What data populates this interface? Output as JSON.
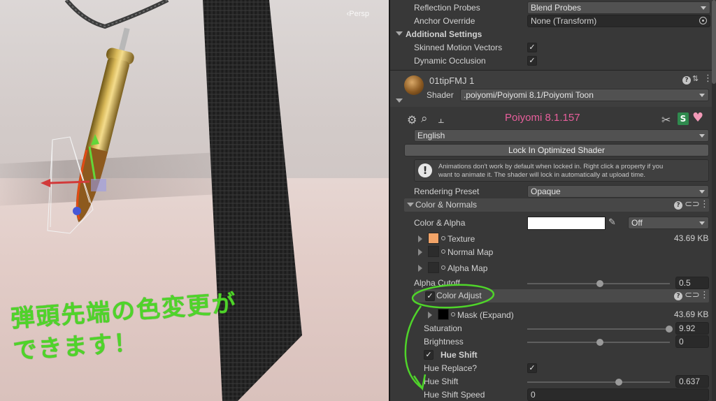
{
  "scene": {
    "persp_label": "‹Persp",
    "caption_line1": "弾頭先端の色変更が",
    "caption_line2": "できます！"
  },
  "top_rows": [
    {
      "label": "Reflection Probes",
      "value": "Blend Probes",
      "type": "dropdown"
    },
    {
      "label": "Anchor Override",
      "value": "None (Transform)",
      "type": "object"
    }
  ],
  "additional_settings": {
    "title": "Additional Settings",
    "rows": [
      {
        "label": "Skinned Motion Vectors",
        "checked": true
      },
      {
        "label": "Dynamic Occlusion",
        "checked": true
      }
    ]
  },
  "material": {
    "name": "01tipFMJ 1",
    "shader_label": "Shader",
    "shader_value": ".poiyomi/Poiyomi 8.1/Poiyomi Toon"
  },
  "poiyomi": {
    "title": "Poiyomi 8.1.157",
    "title_color": "#e85f9c",
    "language": "English",
    "lock_button": "Lock In Optimized Shader",
    "info_text_1": "Animations don't work by default when locked in. Right click a property if you",
    "info_text_2": "want to animate it. The shader will lock in automatically at upload time.",
    "rendering_preset_label": "Rendering Preset",
    "rendering_preset_value": "Opaque"
  },
  "color_normals": {
    "title": "Color & Normals",
    "color_alpha_label": "Color & Alpha",
    "color_alpha_mode": "Off",
    "texture_label": "Texture",
    "texture_size": "43.69 KB",
    "normal_map_label": "Normal Map",
    "alpha_map_label": "Alpha Map",
    "alpha_cutoff_label": "Alpha Cutoff",
    "alpha_cutoff_value": "0.5",
    "alpha_cutoff_fraction": 0.5
  },
  "color_adjust": {
    "title": "Color Adjust",
    "enabled": true,
    "mask_label": "Mask (Expand)",
    "mask_size": "43.69 KB",
    "saturation_label": "Saturation",
    "saturation_value": "9.92",
    "saturation_fraction": 1.0,
    "brightness_label": "Brightness",
    "brightness_value": "0",
    "brightness_fraction": 0.5,
    "hue_shift_section": "Hue Shift",
    "hue_shift_enabled": true,
    "hue_replace_label": "Hue Replace?",
    "hue_replace_checked": true,
    "hue_shift_label": "Hue Shift",
    "hue_shift_value": "0.637",
    "hue_shift_fraction": 0.637,
    "hue_shift_speed_label": "Hue Shift Speed",
    "hue_shift_speed_value": "0"
  },
  "icons": {
    "settings": "gear-icon",
    "search": "search-icon",
    "presets": "sliders-icon",
    "tools": "tools-icon",
    "substance": "s-logo-icon",
    "patreon": "heart-icon"
  }
}
